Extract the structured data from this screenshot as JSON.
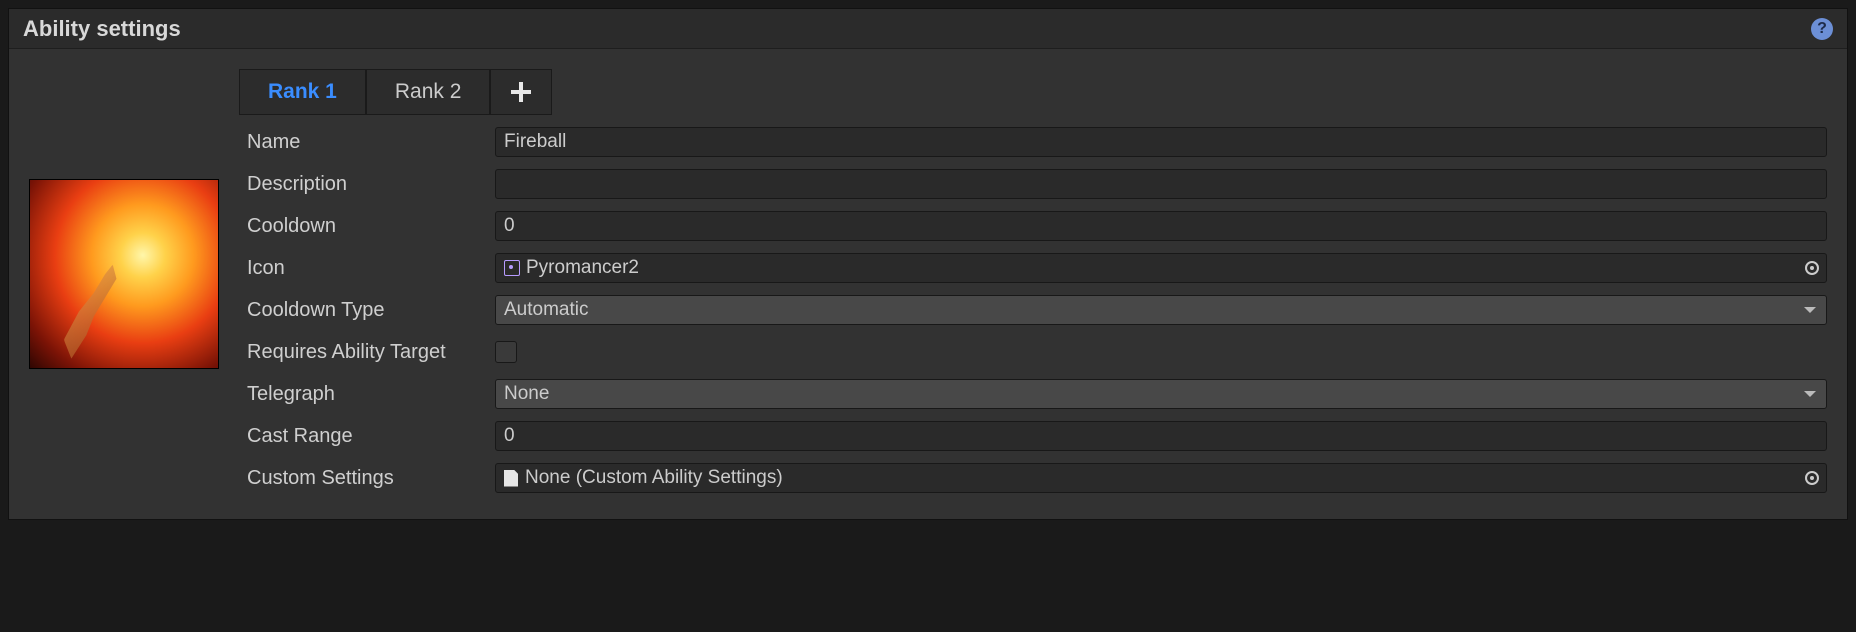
{
  "panel": {
    "title": "Ability settings"
  },
  "tabs": [
    {
      "label": "Rank 1",
      "active": true
    },
    {
      "label": "Rank 2",
      "active": false
    }
  ],
  "fields": {
    "name": {
      "label": "Name",
      "value": "Fireball"
    },
    "description": {
      "label": "Description",
      "value": ""
    },
    "cooldown": {
      "label": "Cooldown",
      "value": "0"
    },
    "icon": {
      "label": "Icon",
      "value": "Pyromancer2"
    },
    "cooldownType": {
      "label": "Cooldown Type",
      "value": "Automatic"
    },
    "requiresAbilityTarget": {
      "label": "Requires Ability Target",
      "checked": false
    },
    "telegraph": {
      "label": "Telegraph",
      "value": "None"
    },
    "castRange": {
      "label": "Cast Range",
      "value": "0"
    },
    "customSettings": {
      "label": "Custom Settings",
      "value": "None (Custom Ability Settings)"
    }
  }
}
